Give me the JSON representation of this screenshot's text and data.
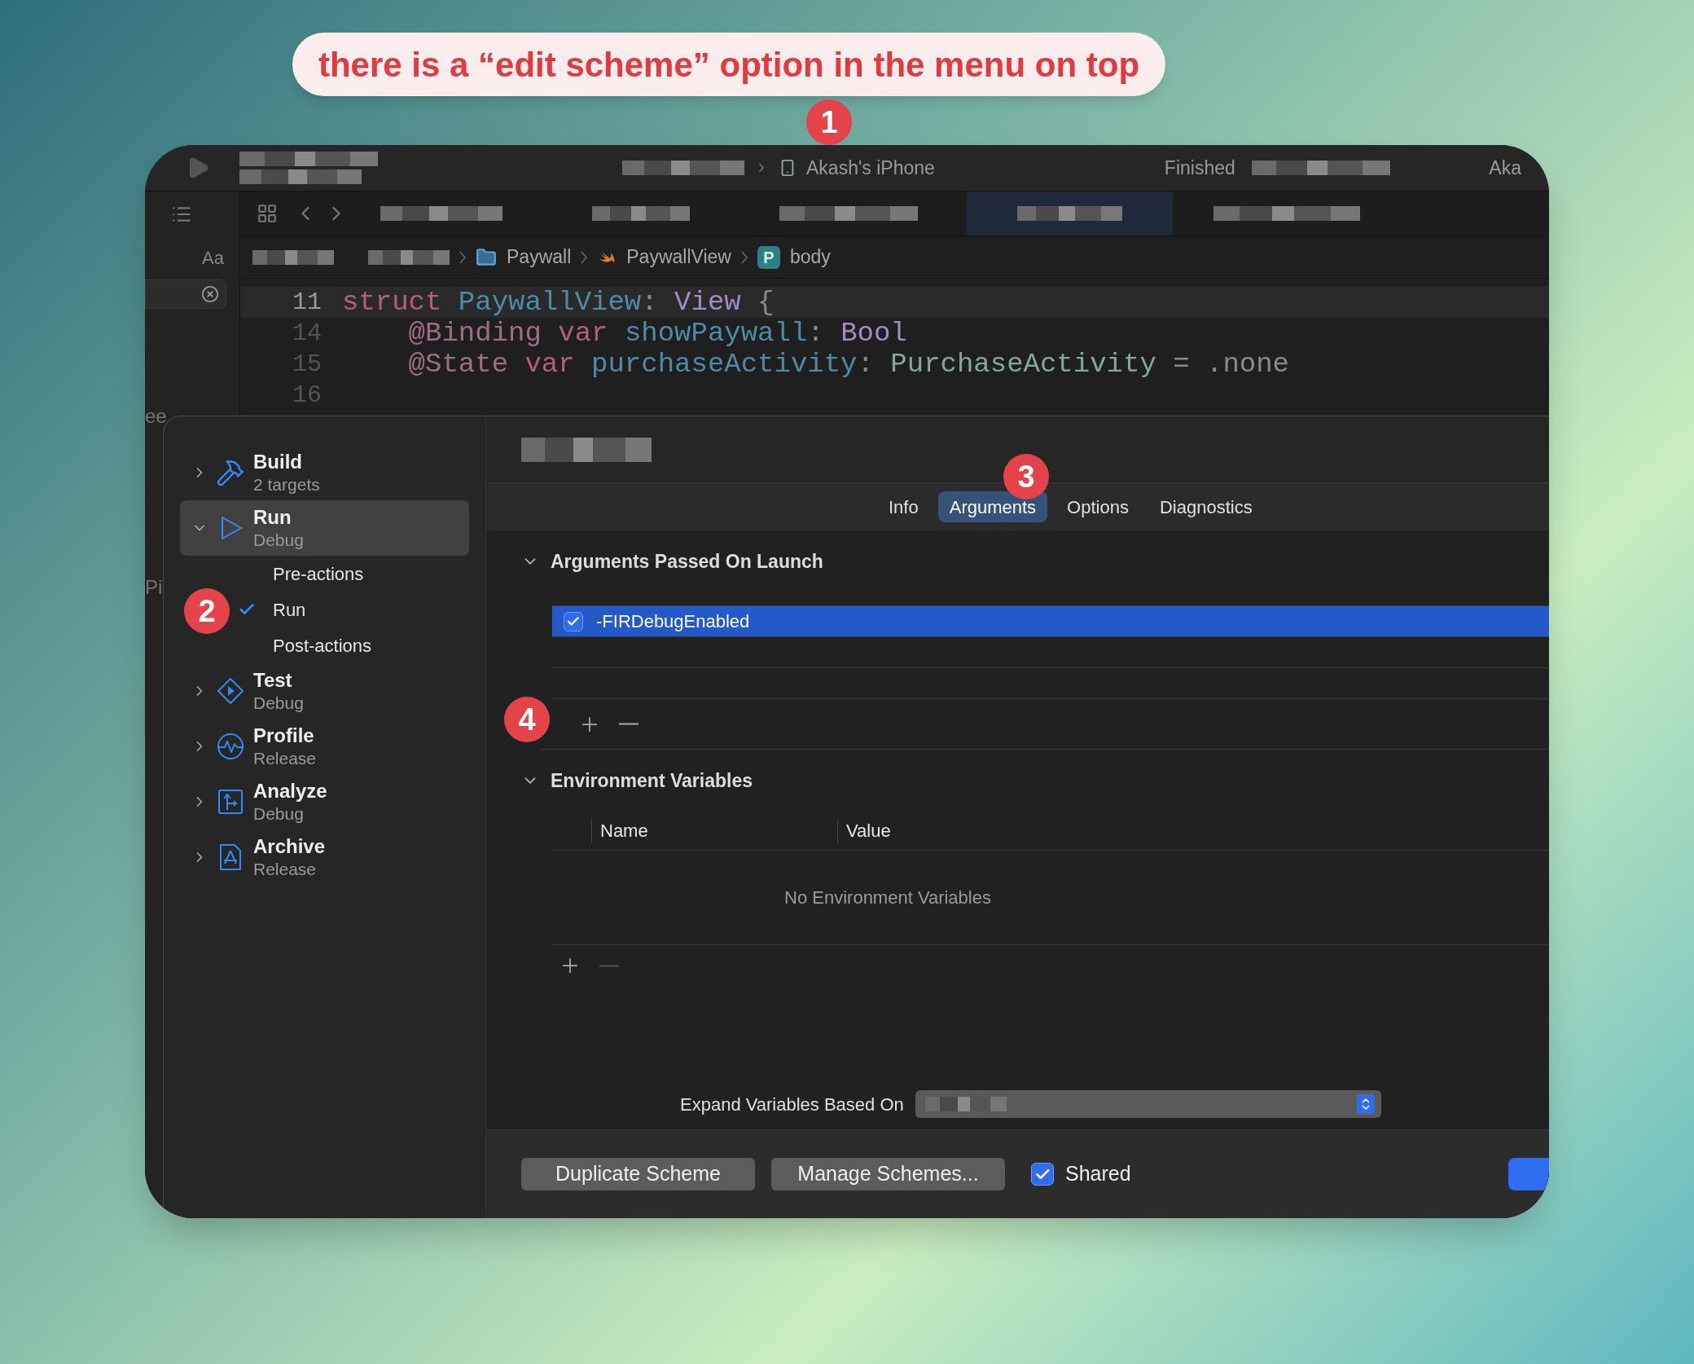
{
  "callout": {
    "text": "there is a “edit scheme” option in the menu on top"
  },
  "annotations": [
    {
      "label": "1"
    },
    {
      "label": "2"
    },
    {
      "label": "3"
    },
    {
      "label": "4"
    }
  ],
  "toolbar": {
    "device": "Akash's iPhone",
    "status": "Finished",
    "cut_text": "Aka"
  },
  "navigator": {
    "font_label": "Aa",
    "cut_texts": [
      "ee",
      "Pi"
    ]
  },
  "breadcrumb": [
    {
      "label": "Paywall",
      "kind": "folder"
    },
    {
      "label": "PaywallView",
      "kind": "swift"
    },
    {
      "label": "body",
      "kind": "property",
      "badge": "P"
    }
  ],
  "code": [
    {
      "number": "11",
      "current": true,
      "tokens": [
        {
          "text": "struct ",
          "kind": "keyword"
        },
        {
          "text": "PaywallView",
          "kind": "decl"
        },
        {
          "text": ": ",
          "kind": "plain"
        },
        {
          "text": "View",
          "kind": "type"
        },
        {
          "text": " {",
          "kind": "plain"
        }
      ]
    },
    {
      "number": "14",
      "current": false,
      "tokens": [
        {
          "text": "    @Binding ",
          "kind": "attr"
        },
        {
          "text": "var ",
          "kind": "keyword"
        },
        {
          "text": "showPaywall",
          "kind": "decl"
        },
        {
          "text": ": ",
          "kind": "plain"
        },
        {
          "text": "Bool",
          "kind": "type"
        }
      ]
    },
    {
      "number": "15",
      "current": false,
      "tokens": [
        {
          "text": "    @State ",
          "kind": "attr"
        },
        {
          "text": "var ",
          "kind": "keyword"
        },
        {
          "text": "purchaseActivity",
          "kind": "decl"
        },
        {
          "text": ": ",
          "kind": "plain"
        },
        {
          "text": "PurchaseActivity",
          "kind": "project_type"
        },
        {
          "text": " = .none",
          "kind": "plain"
        }
      ]
    },
    {
      "number": "16",
      "current": false
    }
  ],
  "scheme_sidebar": [
    {
      "title": "Build",
      "subtitle": "2 targets",
      "kind": "build",
      "expanded": false,
      "selected": false
    },
    {
      "title": "Run",
      "subtitle": "Debug",
      "kind": "run",
      "expanded": true,
      "selected": true,
      "children": [
        {
          "label": "Pre-actions",
          "checked": false
        },
        {
          "label": "Run",
          "checked": true
        },
        {
          "label": "Post-actions",
          "checked": false
        }
      ]
    },
    {
      "title": "Test",
      "subtitle": "Debug",
      "kind": "test",
      "expanded": false,
      "selected": false
    },
    {
      "title": "Profile",
      "subtitle": "Release",
      "kind": "profile",
      "expanded": false,
      "selected": false
    },
    {
      "title": "Analyze",
      "subtitle": "Debug",
      "kind": "analyze",
      "expanded": false,
      "selected": false
    },
    {
      "title": "Archive",
      "subtitle": "Release",
      "kind": "archive",
      "expanded": false,
      "selected": false
    }
  ],
  "tabs": [
    {
      "label": "Info",
      "selected": false
    },
    {
      "label": "Arguments",
      "selected": true
    },
    {
      "label": "Options",
      "selected": false
    },
    {
      "label": "Diagnostics",
      "selected": false
    }
  ],
  "arguments_section": {
    "title": "Arguments Passed On Launch",
    "expanded": true,
    "rows": [
      {
        "text": "-FIRDebugEnabled",
        "checked": true,
        "selected": true
      }
    ]
  },
  "environment_section": {
    "title": "Environment Variables",
    "expanded": true,
    "columns": [
      "Name",
      "Value"
    ],
    "empty_text": "No Environment Variables"
  },
  "expand_variables": {
    "label": "Expand Variables Based On"
  },
  "footer": {
    "buttons": [
      "Duplicate Scheme",
      "Manage Schemes..."
    ],
    "shared": {
      "label": "Shared",
      "checked": true
    }
  }
}
